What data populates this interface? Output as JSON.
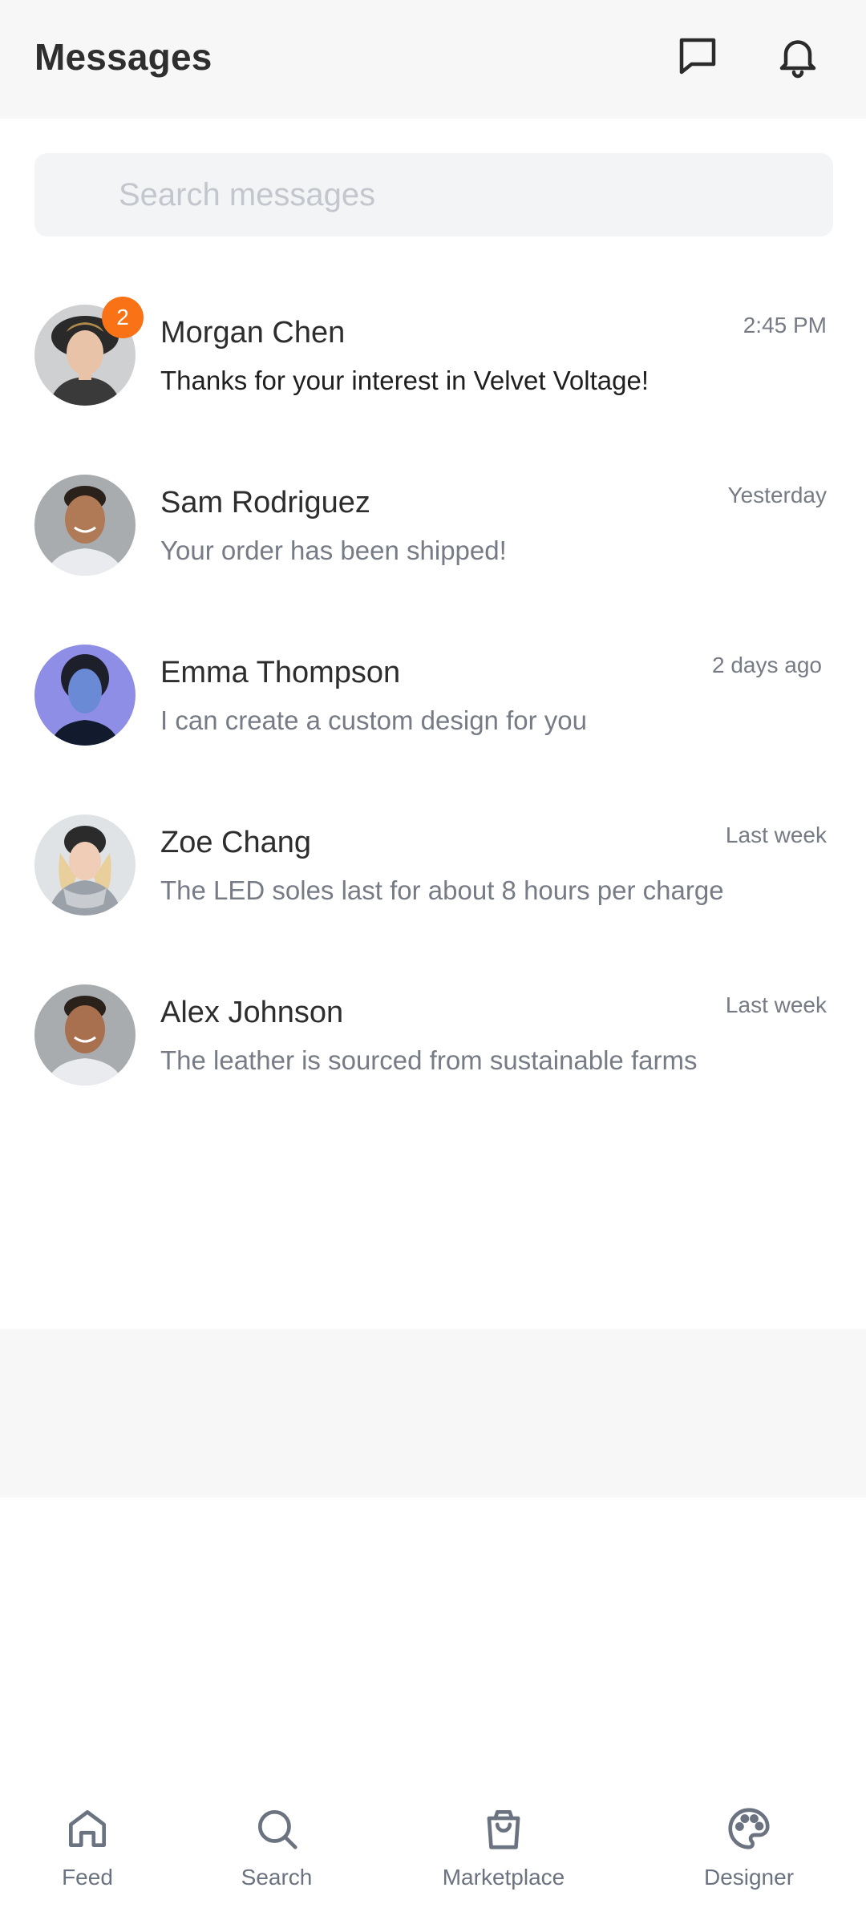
{
  "header": {
    "title": "Messages",
    "icons": [
      "chat-bubble-icon",
      "bell-icon"
    ]
  },
  "search": {
    "placeholder": "Search messages",
    "value": ""
  },
  "conversations": [
    {
      "name": "Morgan Chen",
      "time": "2:45 PM",
      "preview": "Thanks for your interest in Velvet Voltage!",
      "unread_count": "2",
      "unread": true
    },
    {
      "name": "Sam Rodriguez",
      "time": "Yesterday",
      "preview": "Your order has been shipped!",
      "unread": false
    },
    {
      "name": "Emma Thompson",
      "time": "2 days ago",
      "preview": "I can create a custom design for you",
      "unread": false
    },
    {
      "name": "Zoe Chang",
      "time": "Last week",
      "preview": "The LED soles last for about 8 hours per charge",
      "unread": false
    },
    {
      "name": "Alex Johnson",
      "time": "Last week",
      "preview": "The leather is sourced from sustainable farms",
      "unread": false
    }
  ],
  "bottom_nav": [
    {
      "label": "Feed",
      "icon": "home-icon"
    },
    {
      "label": "Search",
      "icon": "search-icon"
    },
    {
      "label": "Marketplace",
      "icon": "shopping-bag-icon"
    },
    {
      "label": "Designer",
      "icon": "palette-icon"
    }
  ],
  "colors": {
    "accent_badge": "#f97316",
    "header_bg": "#f7f7f7",
    "search_bg": "#f3f4f6",
    "muted_text": "#767b85"
  }
}
